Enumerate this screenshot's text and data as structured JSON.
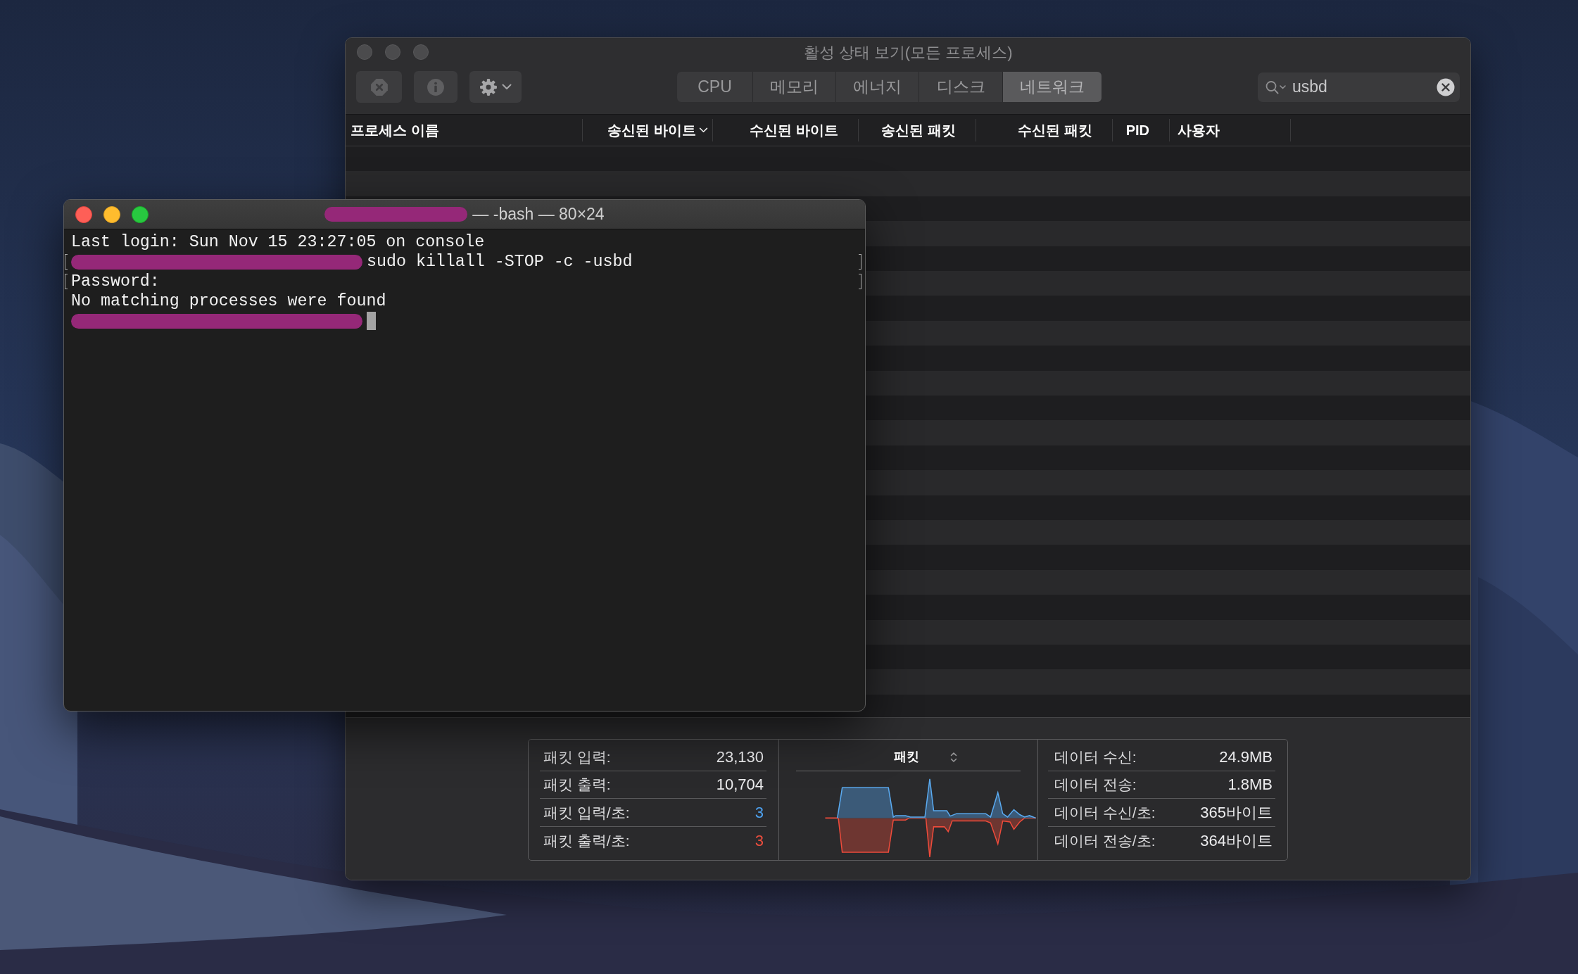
{
  "activity_monitor": {
    "active": false,
    "title": "활성 상태 보기(모든 프로세스)",
    "toolbar_buttons": [
      {
        "kind": "stop",
        "disabled": true
      },
      {
        "kind": "info",
        "disabled": true
      },
      {
        "kind": "action",
        "disabled": false
      }
    ],
    "tabs": [
      {
        "label": "CPU",
        "selected": false
      },
      {
        "label": "메모리",
        "selected": false
      },
      {
        "label": "에너지",
        "selected": false
      },
      {
        "label": "디스크",
        "selected": false
      },
      {
        "label": "네트워크",
        "selected": true
      }
    ],
    "search": {
      "value": "usbd"
    },
    "columns": [
      {
        "label": "프로세스 이름",
        "sorted": false
      },
      {
        "label": "송신된 바이트",
        "sorted": true
      },
      {
        "label": "수신된 바이트",
        "sorted": false
      },
      {
        "label": "송신된 패킷",
        "sorted": false
      },
      {
        "label": "수신된 패킷",
        "sorted": false
      },
      {
        "label": "PID",
        "sorted": false
      },
      {
        "label": "사용자",
        "sorted": false
      }
    ],
    "packets": [
      {
        "label": "패킷 입력:",
        "value": "23,130"
      },
      {
        "label": "패킷 출력:",
        "value": "10,704"
      },
      {
        "label": "패킷 입력/초:",
        "value": "3",
        "color": "#4ea3f3"
      },
      {
        "label": "패킷 출력/초:",
        "value": "3",
        "color": "#f04e3e"
      }
    ],
    "graph": {
      "title": "패킷"
    },
    "data": [
      {
        "label": "데이터 수신:",
        "value": "24.9MB"
      },
      {
        "label": "데이터 전송:",
        "value": "1.8MB"
      },
      {
        "label": "데이터 수신/초:",
        "value": "365바이트"
      },
      {
        "label": "데이터 전송/초:",
        "value": "364바이트"
      }
    ]
  },
  "terminal": {
    "active": true,
    "title": "— -bash — 80×24",
    "title_redacted": true,
    "lines": [
      {
        "text": "Last login: Sun Nov 15 23:27:05 on console",
        "redacted": false,
        "marked": false,
        "cursor": false
      },
      {
        "text": "sudo killall -STOP -c -usbd",
        "redacted": true,
        "marked": true,
        "cursor": false
      },
      {
        "text": "Password:",
        "redacted": false,
        "marked": true,
        "cursor": false
      },
      {
        "text": "No matching processes were found",
        "redacted": false,
        "marked": false,
        "cursor": false
      },
      {
        "redacted": true,
        "marked": false,
        "cursor": true
      }
    ]
  }
}
